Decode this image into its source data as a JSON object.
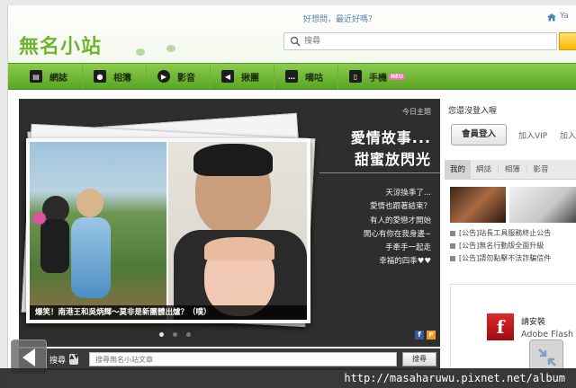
{
  "header": {
    "logo": "無名小站",
    "greeting": "好想問，最近好嗎？",
    "top_right_text": "Ya",
    "search_placeholder": "搜尋"
  },
  "nav": {
    "items": [
      {
        "label": "網誌",
        "icon": "blog-icon"
      },
      {
        "label": "相簿",
        "icon": "camera-icon"
      },
      {
        "label": "影音",
        "icon": "play-icon"
      },
      {
        "label": "揪團",
        "icon": "megaphone-icon"
      },
      {
        "label": "嘀咕",
        "icon": "chat-icon"
      },
      {
        "label": "手機",
        "icon": "phone-icon",
        "badge": "NEU"
      }
    ]
  },
  "feature": {
    "today_label": "今日主題",
    "headline_line1": "愛情故事...",
    "headline_line2": "甜蜜放閃光",
    "poem": [
      "天涼換季了...",
      "愛情也跟著結束？",
      "有人的愛戀才開始",
      "開心有你在我身邊∼",
      "手牽手一起走",
      "幸福的四季♥♥"
    ],
    "caption": "爆笑！南港王和吳炳輝～莫非是新團體出爐？（噗）",
    "slide_count": 3,
    "active_slide": 1,
    "share_facebook": "f",
    "share_pixnet": "P"
  },
  "bottom_search": {
    "label": "搜尋",
    "dropdown": "▲▼",
    "placeholder": "搜尋無名小站文章",
    "button": "搜尋"
  },
  "right": {
    "login_note": "您還沒登入喔",
    "member_login": "會員登入",
    "join_vip": "加入VIP",
    "join_more": "加入",
    "tabs": [
      "我的",
      "網誌",
      "相簿",
      "影音"
    ],
    "notices": [
      "[公告]站長工具服務終止公告",
      "[公告]無名行動版全面升級",
      "[公告]請勿點擊不法詐騙信件"
    ],
    "flash_install": "請安裝",
    "flash_name": "Adobe Flash"
  },
  "url_bar": {
    "text": "http://masaharuwu.pixnet.net/album"
  }
}
